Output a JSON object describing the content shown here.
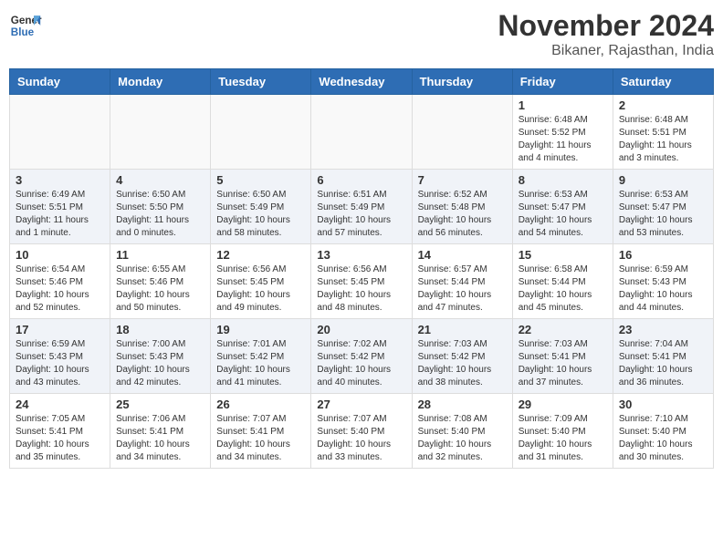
{
  "header": {
    "logo": {
      "line1": "General",
      "line2": "Blue"
    },
    "title": "November 2024",
    "subtitle": "Bikaner, Rajasthan, India"
  },
  "calendar": {
    "days_of_week": [
      "Sunday",
      "Monday",
      "Tuesday",
      "Wednesday",
      "Thursday",
      "Friday",
      "Saturday"
    ],
    "weeks": [
      [
        {
          "day": "",
          "info": ""
        },
        {
          "day": "",
          "info": ""
        },
        {
          "day": "",
          "info": ""
        },
        {
          "day": "",
          "info": ""
        },
        {
          "day": "",
          "info": ""
        },
        {
          "day": "1",
          "info": "Sunrise: 6:48 AM\nSunset: 5:52 PM\nDaylight: 11 hours\nand 4 minutes."
        },
        {
          "day": "2",
          "info": "Sunrise: 6:48 AM\nSunset: 5:51 PM\nDaylight: 11 hours\nand 3 minutes."
        }
      ],
      [
        {
          "day": "3",
          "info": "Sunrise: 6:49 AM\nSunset: 5:51 PM\nDaylight: 11 hours\nand 1 minute."
        },
        {
          "day": "4",
          "info": "Sunrise: 6:50 AM\nSunset: 5:50 PM\nDaylight: 11 hours\nand 0 minutes."
        },
        {
          "day": "5",
          "info": "Sunrise: 6:50 AM\nSunset: 5:49 PM\nDaylight: 10 hours\nand 58 minutes."
        },
        {
          "day": "6",
          "info": "Sunrise: 6:51 AM\nSunset: 5:49 PM\nDaylight: 10 hours\nand 57 minutes."
        },
        {
          "day": "7",
          "info": "Sunrise: 6:52 AM\nSunset: 5:48 PM\nDaylight: 10 hours\nand 56 minutes."
        },
        {
          "day": "8",
          "info": "Sunrise: 6:53 AM\nSunset: 5:47 PM\nDaylight: 10 hours\nand 54 minutes."
        },
        {
          "day": "9",
          "info": "Sunrise: 6:53 AM\nSunset: 5:47 PM\nDaylight: 10 hours\nand 53 minutes."
        }
      ],
      [
        {
          "day": "10",
          "info": "Sunrise: 6:54 AM\nSunset: 5:46 PM\nDaylight: 10 hours\nand 52 minutes."
        },
        {
          "day": "11",
          "info": "Sunrise: 6:55 AM\nSunset: 5:46 PM\nDaylight: 10 hours\nand 50 minutes."
        },
        {
          "day": "12",
          "info": "Sunrise: 6:56 AM\nSunset: 5:45 PM\nDaylight: 10 hours\nand 49 minutes."
        },
        {
          "day": "13",
          "info": "Sunrise: 6:56 AM\nSunset: 5:45 PM\nDaylight: 10 hours\nand 48 minutes."
        },
        {
          "day": "14",
          "info": "Sunrise: 6:57 AM\nSunset: 5:44 PM\nDaylight: 10 hours\nand 47 minutes."
        },
        {
          "day": "15",
          "info": "Sunrise: 6:58 AM\nSunset: 5:44 PM\nDaylight: 10 hours\nand 45 minutes."
        },
        {
          "day": "16",
          "info": "Sunrise: 6:59 AM\nSunset: 5:43 PM\nDaylight: 10 hours\nand 44 minutes."
        }
      ],
      [
        {
          "day": "17",
          "info": "Sunrise: 6:59 AM\nSunset: 5:43 PM\nDaylight: 10 hours\nand 43 minutes."
        },
        {
          "day": "18",
          "info": "Sunrise: 7:00 AM\nSunset: 5:43 PM\nDaylight: 10 hours\nand 42 minutes."
        },
        {
          "day": "19",
          "info": "Sunrise: 7:01 AM\nSunset: 5:42 PM\nDaylight: 10 hours\nand 41 minutes."
        },
        {
          "day": "20",
          "info": "Sunrise: 7:02 AM\nSunset: 5:42 PM\nDaylight: 10 hours\nand 40 minutes."
        },
        {
          "day": "21",
          "info": "Sunrise: 7:03 AM\nSunset: 5:42 PM\nDaylight: 10 hours\nand 38 minutes."
        },
        {
          "day": "22",
          "info": "Sunrise: 7:03 AM\nSunset: 5:41 PM\nDaylight: 10 hours\nand 37 minutes."
        },
        {
          "day": "23",
          "info": "Sunrise: 7:04 AM\nSunset: 5:41 PM\nDaylight: 10 hours\nand 36 minutes."
        }
      ],
      [
        {
          "day": "24",
          "info": "Sunrise: 7:05 AM\nSunset: 5:41 PM\nDaylight: 10 hours\nand 35 minutes."
        },
        {
          "day": "25",
          "info": "Sunrise: 7:06 AM\nSunset: 5:41 PM\nDaylight: 10 hours\nand 34 minutes."
        },
        {
          "day": "26",
          "info": "Sunrise: 7:07 AM\nSunset: 5:41 PM\nDaylight: 10 hours\nand 34 minutes."
        },
        {
          "day": "27",
          "info": "Sunrise: 7:07 AM\nSunset: 5:40 PM\nDaylight: 10 hours\nand 33 minutes."
        },
        {
          "day": "28",
          "info": "Sunrise: 7:08 AM\nSunset: 5:40 PM\nDaylight: 10 hours\nand 32 minutes."
        },
        {
          "day": "29",
          "info": "Sunrise: 7:09 AM\nSunset: 5:40 PM\nDaylight: 10 hours\nand 31 minutes."
        },
        {
          "day": "30",
          "info": "Sunrise: 7:10 AM\nSunset: 5:40 PM\nDaylight: 10 hours\nand 30 minutes."
        }
      ]
    ]
  }
}
